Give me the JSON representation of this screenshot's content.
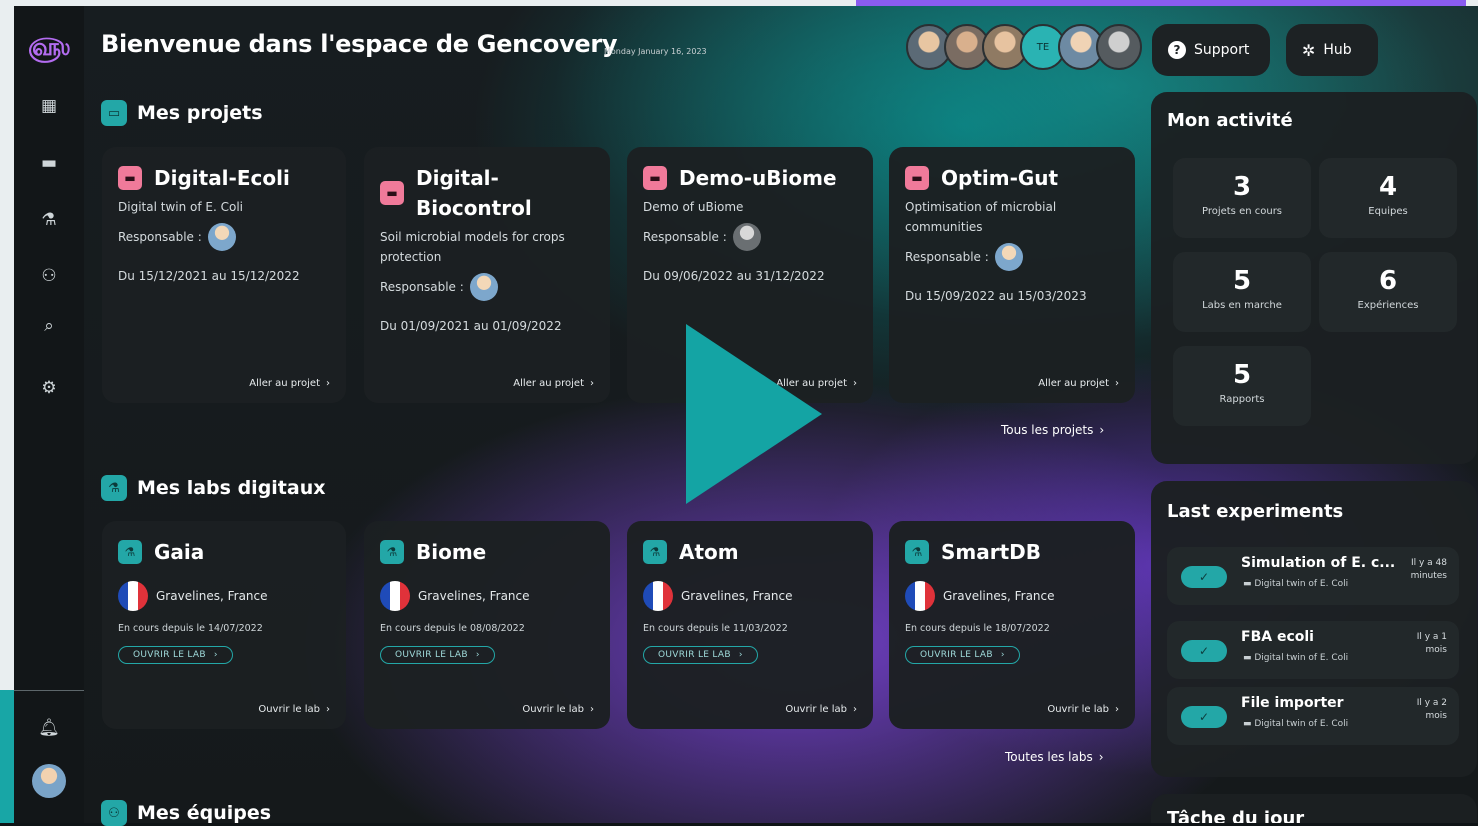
{
  "header": {
    "welcome": "Bienvenue dans l'espace de Gencovery",
    "date": "Monday January 16, 2023",
    "avatars": [
      {
        "label": ""
      },
      {
        "label": ""
      },
      {
        "label": ""
      },
      {
        "label": "TE"
      },
      {
        "label": ""
      },
      {
        "label": ""
      }
    ],
    "support_label": "Support",
    "hub_label": "Hub"
  },
  "sidebar": {
    "items": [
      "dashboard-icon",
      "briefcase-icon",
      "lab-icon",
      "team-icon",
      "search-icon",
      "settings-icon"
    ],
    "notification_icon": "bell-icon"
  },
  "projects": {
    "section_title": "Mes projets",
    "all_link": "Tous les projets",
    "responsable_label": "Responsable :",
    "go_link": "Aller au projet",
    "items": [
      {
        "title": "Digital-Ecoli",
        "desc": "Digital twin of E. Coli",
        "dates": "Du 15/12/2021 au 15/12/2022"
      },
      {
        "title": "Digital-Biocontrol",
        "desc": "Soil microbial models for crops protection",
        "dates": "Du 01/09/2021 au 01/09/2022"
      },
      {
        "title": "Demo-uBiome",
        "desc": "Demo of uBiome",
        "dates": "Du 09/06/2022 au 31/12/2022"
      },
      {
        "title": "Optim-Gut",
        "desc": "Optimisation of microbial communities",
        "dates": "Du 15/09/2022 au 15/03/2023"
      }
    ]
  },
  "labs": {
    "section_title": "Mes labs digitaux",
    "all_link": "Toutes les labs",
    "open_button": "OUVRIR LE LAB",
    "open_link": "Ouvrir le lab",
    "items": [
      {
        "title": "Gaia",
        "location": "Gravelines, France",
        "since": "En cours depuis le 14/07/2022"
      },
      {
        "title": "Biome",
        "location": "Gravelines, France",
        "since": "En cours depuis le 08/08/2022"
      },
      {
        "title": "Atom",
        "location": "Gravelines, France",
        "since": "En cours depuis le 11/03/2022"
      },
      {
        "title": "SmartDB",
        "location": "Gravelines, France",
        "since": "En cours depuis le 18/07/2022"
      }
    ]
  },
  "teams": {
    "section_title": "Mes équipes"
  },
  "activity": {
    "title": "Mon activité",
    "stats": [
      {
        "value": "3",
        "label": "Projets en cours"
      },
      {
        "value": "4",
        "label": "Equipes"
      },
      {
        "value": "5",
        "label": "Labs en marche"
      },
      {
        "value": "6",
        "label": "Expériences"
      },
      {
        "value": "5",
        "label": "Rapports"
      }
    ]
  },
  "experiments": {
    "title": "Last experiments",
    "items": [
      {
        "name": "Simulation of E. c...",
        "project": "Digital twin of E. Coli",
        "ago_1": "Il y a 48",
        "ago_2": "minutes"
      },
      {
        "name": "FBA ecoli",
        "project": "Digital twin of E. Coli",
        "ago_1": "Il y a 1",
        "ago_2": "mois"
      },
      {
        "name": "File importer",
        "project": "Digital twin of E. Coli",
        "ago_1": "Il y a 2",
        "ago_2": "mois"
      }
    ]
  },
  "tasks": {
    "title": "Tâche du jour"
  },
  "colors": {
    "accent_teal": "#23a7a7",
    "accent_pink": "#f07a9a",
    "accent_purple": "#8a5cf0"
  }
}
